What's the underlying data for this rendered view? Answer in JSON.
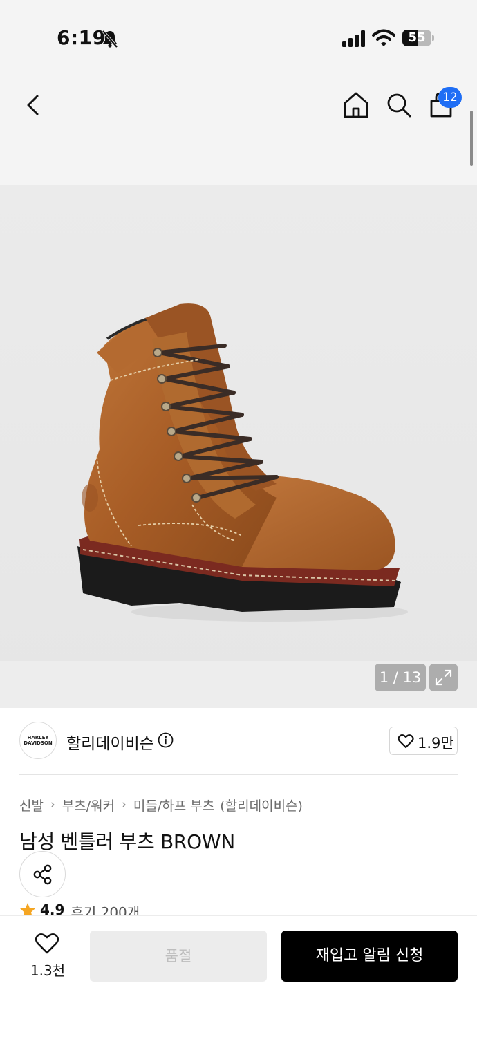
{
  "status_bar": {
    "time": "6:19",
    "battery": "55",
    "battery_level": 0.55
  },
  "header": {
    "icons": [
      "chevron-left-icon",
      "home-icon",
      "search-icon",
      "shopping-bag-icon"
    ],
    "cart_count": "12"
  },
  "gallery": {
    "counter": "1 / 13"
  },
  "brand": {
    "logo_line1": "HARLEY",
    "logo_line2": "DAVIDSON",
    "name": "할리데이비슨",
    "likes": "1.9만"
  },
  "breadcrumb": {
    "items": [
      "신발",
      "부츠/워커",
      "미들/하프 부츠"
    ],
    "brand_suffix": "(할리데이비슨)"
  },
  "product": {
    "title": "남성 벤틀러 부츠 BROWN",
    "rating": "4.9",
    "reviews": "후기 200개"
  },
  "bottom_bar": {
    "wish_count": "1.3천",
    "soldout_label": "품절",
    "restock_label": "재입고 알림 신청"
  },
  "colors": {
    "accent_blue": "#1f6ef5",
    "star": "#f5a623",
    "primary_button": "#000000",
    "disabled_button": "#ececec"
  }
}
